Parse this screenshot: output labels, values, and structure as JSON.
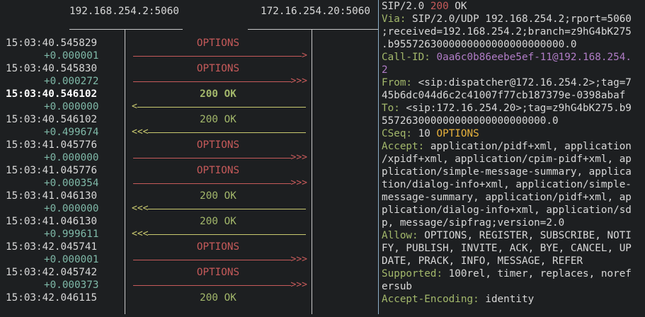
{
  "flow": {
    "endpoints": [
      "192.168.254.2:5060",
      "172.16.254.20:5060"
    ],
    "colors": {
      "request": "#c65a5a",
      "response": "#a3b86b",
      "request_line": "#c65a5a",
      "response_line": "#c9c96f",
      "timestamp": "#d8d8d8",
      "delta": "#7fb9a8"
    },
    "messages": [
      {
        "time": "15:03:40.545829",
        "delta": "+0.000001",
        "label": "OPTIONS",
        "kind": "request",
        "direction": "right",
        "head": ">",
        "selected": false
      },
      {
        "time": "15:03:40.545830",
        "delta": "+0.000272",
        "label": "OPTIONS",
        "kind": "request",
        "direction": "right",
        "head": ">>>",
        "selected": false
      },
      {
        "time": "15:03:40.546102",
        "delta": "+0.000000",
        "label": "200 OK",
        "kind": "response",
        "direction": "left",
        "head": "<",
        "selected": true
      },
      {
        "time": "15:03:40.546102",
        "delta": "+0.499674",
        "label": "200 OK",
        "kind": "response",
        "direction": "left",
        "head": "<<<",
        "selected": false
      },
      {
        "time": "15:03:41.045776",
        "delta": "+0.000000",
        "label": "OPTIONS",
        "kind": "request",
        "direction": "right",
        "head": ">>>",
        "selected": false
      },
      {
        "time": "15:03:41.045776",
        "delta": "+0.000354",
        "label": "OPTIONS",
        "kind": "request",
        "direction": "right",
        "head": ">>>",
        "selected": false
      },
      {
        "time": "15:03:41.046130",
        "delta": "+0.000000",
        "label": "200 OK",
        "kind": "response",
        "direction": "left",
        "head": "<<<",
        "selected": false
      },
      {
        "time": "15:03:41.046130",
        "delta": "+0.999611",
        "label": "200 OK",
        "kind": "response",
        "direction": "left",
        "head": "<<<",
        "selected": false
      },
      {
        "time": "15:03:42.045741",
        "delta": "+0.000001",
        "label": "OPTIONS",
        "kind": "request",
        "direction": "right",
        "head": ">>>",
        "selected": false
      },
      {
        "time": "15:03:42.045742",
        "delta": "+0.000373",
        "label": "OPTIONS",
        "kind": "request",
        "direction": "right",
        "head": ">>>",
        "selected": false
      },
      {
        "time": "15:03:42.046115",
        "delta": "",
        "label": "200 OK",
        "kind": "response",
        "direction": "left",
        "head": "",
        "selected": false
      }
    ]
  },
  "detail": {
    "lines": [
      [
        {
          "t": "SIP/2.0 ",
          "c": "hv"
        },
        {
          "t": "200",
          "c": "lab-stat"
        },
        {
          "t": " OK",
          "c": "hv"
        }
      ],
      [
        {
          "t": "Via:",
          "c": "hn"
        },
        {
          "t": " SIP/2.0/UDP 192.168.254.2;rport=5060",
          "c": "hv"
        }
      ],
      [
        {
          "t": ";received=192.168.254.2;branch=z9hG4bK275",
          "c": "hv"
        }
      ],
      [
        {
          "t": ".b9557263000000000000000000000.0",
          "c": "hv"
        }
      ],
      [
        {
          "t": "Call-ID:",
          "c": "hn"
        },
        {
          "t": " 0aa6c0b86eebe5ef-11@192.168.254.",
          "c": "callid"
        }
      ],
      [
        {
          "t": "2",
          "c": "callid"
        }
      ],
      [
        {
          "t": "From:",
          "c": "hn"
        },
        {
          "t": " <sip:dispatcher@172.16.254.2>;tag=7",
          "c": "hv"
        }
      ],
      [
        {
          "t": "45b6dc044d6c2c41007f77cb187379e-0398abaf",
          "c": "hv"
        }
      ],
      [
        {
          "t": "To:",
          "c": "hn"
        },
        {
          "t": " <sip:172.16.254.20>;tag=z9hG4bK275.b9",
          "c": "hv"
        }
      ],
      [
        {
          "t": "557263000000000000000000000.0",
          "c": "hv"
        }
      ],
      [
        {
          "t": "CSeq:",
          "c": "hn"
        },
        {
          "t": " 10 ",
          "c": "hv"
        },
        {
          "t": "OPTIONS",
          "c": "method"
        }
      ],
      [
        {
          "t": "Accept:",
          "c": "hn"
        },
        {
          "t": " application/pidf+xml, application",
          "c": "hv"
        }
      ],
      [
        {
          "t": "/xpidf+xml, application/cpim-pidf+xml, ap",
          "c": "hv"
        }
      ],
      [
        {
          "t": "plication/simple-message-summary, applica",
          "c": "hv"
        }
      ],
      [
        {
          "t": "tion/dialog-info+xml, application/simple-",
          "c": "hv"
        }
      ],
      [
        {
          "t": "message-summary, application/pidf+xml, ap",
          "c": "hv"
        }
      ],
      [
        {
          "t": "plication/dialog-info+xml, application/sd",
          "c": "hv"
        }
      ],
      [
        {
          "t": "p, message/sipfrag;version=2.0",
          "c": "hv"
        }
      ],
      [
        {
          "t": "Allow:",
          "c": "hn"
        },
        {
          "t": " OPTIONS, REGISTER, SUBSCRIBE, NOTI",
          "c": "hv"
        }
      ],
      [
        {
          "t": "FY, PUBLISH, INVITE, ACK, BYE, CANCEL, UP",
          "c": "hv"
        }
      ],
      [
        {
          "t": "DATE, PRACK, INFO, MESSAGE, REFER",
          "c": "hv"
        }
      ],
      [
        {
          "t": "Supported:",
          "c": "hn"
        },
        {
          "t": " 100rel, timer, replaces, noref",
          "c": "hv"
        }
      ],
      [
        {
          "t": "ersub",
          "c": "hv"
        }
      ],
      [
        {
          "t": "Accept-Encoding:",
          "c": "hn"
        },
        {
          "t": " identity",
          "c": "hv"
        }
      ]
    ]
  }
}
